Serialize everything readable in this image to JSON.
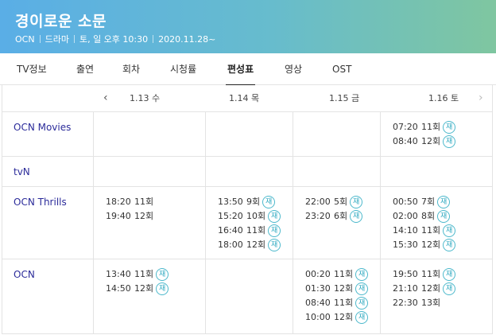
{
  "header": {
    "title": "경이로운 소문",
    "channel": "OCN",
    "genre": "드라마",
    "airtime": "토, 일 오후 10:30",
    "start_date": "2020.11.28~"
  },
  "tabs": [
    {
      "label": "TV정보",
      "active": false
    },
    {
      "label": "출연",
      "active": false
    },
    {
      "label": "회차",
      "active": false
    },
    {
      "label": "시청률",
      "active": false
    },
    {
      "label": "편성표",
      "active": true
    },
    {
      "label": "영상",
      "active": false
    },
    {
      "label": "OST",
      "active": false
    }
  ],
  "days": {
    "prev_icon": "‹",
    "next_icon": "›",
    "items": [
      "1.13 수",
      "1.14 목",
      "1.15 금",
      "1.16 토"
    ]
  },
  "rerun_label": "재",
  "schedule": [
    {
      "channel": "OCN Movies",
      "days": [
        [],
        [],
        [],
        [
          {
            "time": "07:20",
            "ep": "11회",
            "rerun": true
          },
          {
            "time": "08:40",
            "ep": "12회",
            "rerun": true
          }
        ]
      ]
    },
    {
      "channel": "tvN",
      "days": [
        [],
        [],
        [],
        []
      ]
    },
    {
      "channel": "OCN Thrills",
      "days": [
        [
          {
            "time": "18:20",
            "ep": "11회",
            "rerun": false
          },
          {
            "time": "19:40",
            "ep": "12회",
            "rerun": false
          }
        ],
        [
          {
            "time": "13:50",
            "ep": "9회",
            "rerun": true
          },
          {
            "time": "15:20",
            "ep": "10회",
            "rerun": true
          },
          {
            "time": "16:40",
            "ep": "11회",
            "rerun": true
          },
          {
            "time": "18:00",
            "ep": "12회",
            "rerun": true
          }
        ],
        [
          {
            "time": "22:00",
            "ep": "5회",
            "rerun": true
          },
          {
            "time": "23:20",
            "ep": "6회",
            "rerun": true
          }
        ],
        [
          {
            "time": "00:50",
            "ep": "7회",
            "rerun": true
          },
          {
            "time": "02:00",
            "ep": "8회",
            "rerun": true
          },
          {
            "time": "14:10",
            "ep": "11회",
            "rerun": true
          },
          {
            "time": "15:30",
            "ep": "12회",
            "rerun": true
          }
        ]
      ]
    },
    {
      "channel": "OCN",
      "days": [
        [
          {
            "time": "13:40",
            "ep": "11회",
            "rerun": true
          },
          {
            "time": "14:50",
            "ep": "12회",
            "rerun": true
          }
        ],
        [],
        [
          {
            "time": "00:20",
            "ep": "11회",
            "rerun": true
          },
          {
            "time": "01:30",
            "ep": "12회",
            "rerun": true
          },
          {
            "time": "08:40",
            "ep": "11회",
            "rerun": true
          },
          {
            "time": "10:00",
            "ep": "12회",
            "rerun": true
          }
        ],
        [
          {
            "time": "19:50",
            "ep": "11회",
            "rerun": true
          },
          {
            "time": "21:10",
            "ep": "12회",
            "rerun": true
          },
          {
            "time": "22:30",
            "ep": "13회",
            "rerun": false
          }
        ]
      ]
    }
  ]
}
